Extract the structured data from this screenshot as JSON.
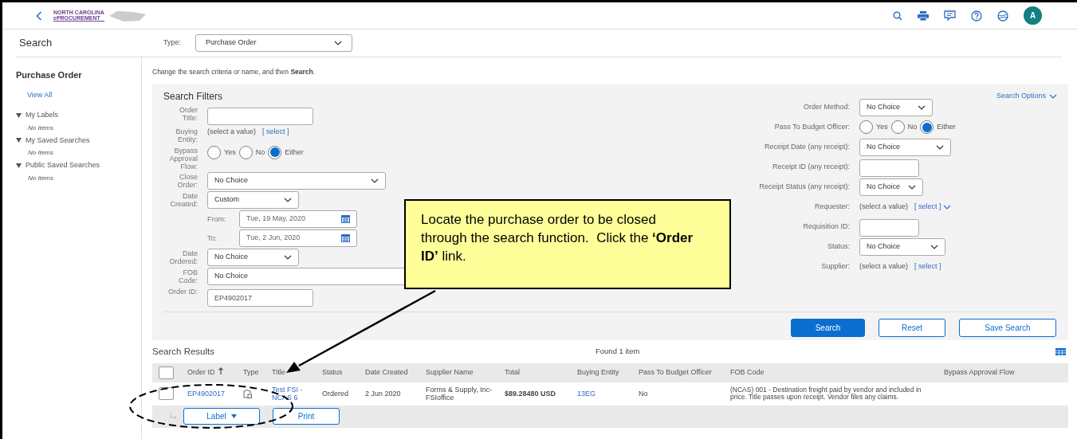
{
  "header": {
    "logo": {
      "line1": "NORTH CAROLINA",
      "line2": "ePROCUREMENT"
    },
    "avatar": "A"
  },
  "search_bar": {
    "title": "Search",
    "type_label": "Type:",
    "type_value": "Purchase Order"
  },
  "sidebar": {
    "title": "Purchase Order",
    "view_all": "View All",
    "sections": [
      {
        "label": "My Labels",
        "expanded": true,
        "empty_text": "No Items"
      },
      {
        "label": "My Saved Searches",
        "expanded": true,
        "empty_text": "No Items"
      },
      {
        "label": "Public Saved Searches",
        "expanded": true,
        "empty_text": "No Items"
      }
    ]
  },
  "instructions": {
    "text": "Change the search criteria or name, and then **Search**."
  },
  "filters": {
    "title": "Search Filters",
    "options_link": "Search Options",
    "left": [
      {
        "kind": "input",
        "label": "Order Title:"
      },
      {
        "kind": "picker",
        "label": "Buying Entity:",
        "value": "(select a value)",
        "link": "[ select ]"
      },
      {
        "kind": "radio",
        "label": "Bypass Approval Flow:",
        "options": [
          {
            "label": "Yes",
            "selected": false
          },
          {
            "label": "No",
            "selected": false
          },
          {
            "label": "Either",
            "selected": true
          }
        ]
      },
      {
        "kind": "select",
        "label": "Close Order:",
        "value": "No Choice"
      },
      {
        "kind": "select",
        "label": "Date Created:",
        "value": "Custom"
      },
      {
        "kind": "date",
        "label": "From:",
        "value": "Tue, 19 May, 2020"
      },
      {
        "kind": "date",
        "label": "To:",
        "value": "Tue, 2 Jun, 2020"
      },
      {
        "kind": "select",
        "label": "Date Ordered:",
        "value": "No Choice"
      },
      {
        "kind": "plain",
        "label": "FOB Code:",
        "value": "No Choice"
      },
      {
        "kind": "input",
        "label": "Order ID:",
        "value": "EP4902017"
      }
    ],
    "right": [
      {
        "kind": "select",
        "label": "Order Method:",
        "value": "No Choice"
      },
      {
        "kind": "radio",
        "label": "Pass To Budget Officer:",
        "options": [
          {
            "label": "Yes",
            "selected": false
          },
          {
            "label": "No",
            "selected": false
          },
          {
            "label": "Either",
            "selected": true
          }
        ]
      },
      {
        "kind": "select",
        "label": "Receipt Date (any receipt):",
        "value": "No Choice"
      },
      {
        "kind": "input",
        "label": "Receipt ID (any receipt):"
      },
      {
        "kind": "select",
        "label": "Receipt Status (any receipt):",
        "value": "No Choice"
      },
      {
        "kind": "picker",
        "label": "Requester:",
        "value": "(select a value)",
        "link": "[ select ]",
        "dropdown": true
      },
      {
        "kind": "input",
        "label": "Requisition ID:"
      },
      {
        "kind": "select",
        "label": "Status:",
        "value": "No Choice"
      },
      {
        "kind": "picker",
        "label": "Supplier:",
        "value": "(select a value)",
        "link": "[ select ]"
      }
    ],
    "buttons": [
      {
        "label": "Search",
        "primary": true
      },
      {
        "label": "Reset",
        "primary": false
      },
      {
        "label": "Save Search",
        "primary": false
      }
    ]
  },
  "results": {
    "title": "Search Results",
    "count": "Found 1 item",
    "select_all": {
      "checked": false
    },
    "columns": [
      "Order ID",
      "Type",
      "Title",
      "Status",
      "Date Created",
      "Supplier Name",
      "Total",
      "Buying Entity",
      "Pass To Budget Officer",
      "FOB Code",
      "Bypass Approval Flow"
    ],
    "rows": [
      {
        "checked": false,
        "order_id": "EP4902017",
        "title": "Test FSI - NCAS 6",
        "status": "Ordered",
        "date_created": "2 Jun 2020",
        "supplier": "Forms & Supply, Inc-FSIoffice",
        "total": "$89.28480 USD",
        "buying_entity": "13EG",
        "pass_to_budget_officer": "No",
        "fob_code": "(NCAS) 001 - Destination freight paid by vendor and included in price. Title passes upon receipt. Vendor files any claims."
      }
    ],
    "footer_buttons": [
      "Label",
      "Print"
    ]
  },
  "callout": {
    "text": "Locate the purchase order to be closed through the search function.  Click the **‘Order ID’** link."
  }
}
